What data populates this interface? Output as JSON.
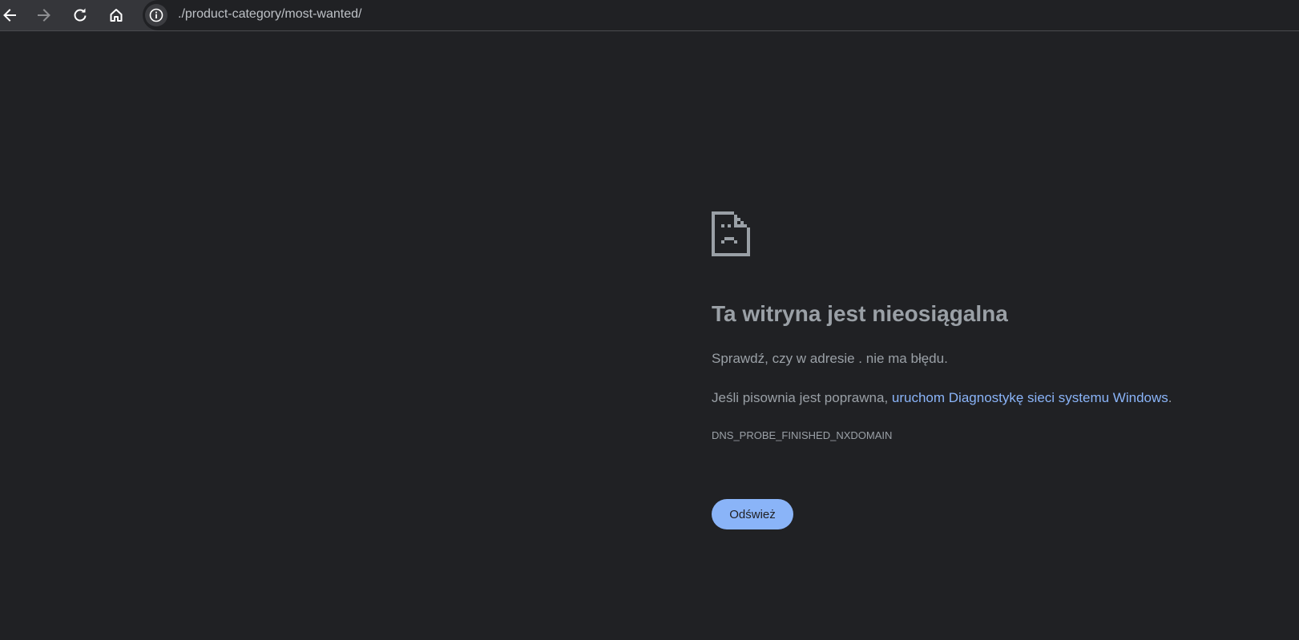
{
  "browser": {
    "back_icon": "arrow-left-icon",
    "forward_icon": "arrow-right-icon",
    "reload_icon": "reload-icon",
    "home_icon": "home-icon",
    "site_info_icon": "info-icon",
    "url": "./product-category/most-wanted/"
  },
  "error_page": {
    "icon": "sad-page-icon",
    "heading": "Ta witryna jest nieosiągalna",
    "line1": "Sprawdź, czy w adresie . nie ma błędu.",
    "line2_prefix": "Jeśli pisownia jest poprawna, ",
    "line2_link": "uruchom Diagnostykę sieci systemu Windows",
    "line2_suffix": ".",
    "error_code": "DNS_PROBE_FINISHED_NXDOMAIN",
    "reload_button": "Odśwież"
  },
  "colors": {
    "background": "#202124",
    "toolbar": "#35363a",
    "text": "#9aa0a6",
    "link": "#8ab4f8",
    "button": "#8ab4f8"
  }
}
